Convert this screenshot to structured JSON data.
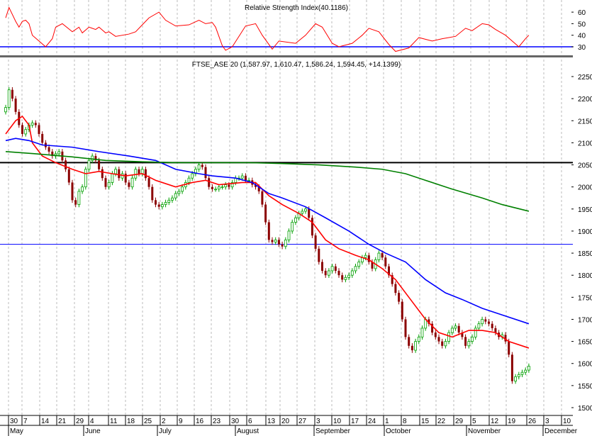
{
  "chart_data": {
    "type": "candlestick",
    "rsi_panel": {
      "title": "Relative Strength Index(40.1186)",
      "y_ticks": [
        "60",
        "50",
        "40",
        "30"
      ],
      "ylim": [
        20,
        68
      ],
      "threshold": 30,
      "color": "#ff0000",
      "threshold_color": "#0000ff",
      "rsi": [
        [
          0,
          55
        ],
        [
          1,
          64
        ],
        [
          3,
          52
        ],
        [
          4,
          47
        ],
        [
          5,
          52
        ],
        [
          6,
          53
        ],
        [
          7,
          50
        ],
        [
          8,
          40
        ],
        [
          10,
          35
        ],
        [
          12,
          30
        ],
        [
          14,
          37
        ],
        [
          15,
          47
        ],
        [
          17,
          50
        ],
        [
          20,
          43
        ],
        [
          22,
          47
        ],
        [
          23,
          42
        ],
        [
          25,
          47
        ],
        [
          27,
          45
        ],
        [
          28,
          47
        ],
        [
          30,
          42
        ],
        [
          31,
          43
        ],
        [
          33,
          39
        ],
        [
          37,
          41
        ],
        [
          39,
          43
        ],
        [
          41,
          49
        ],
        [
          43,
          55
        ],
        [
          46,
          60
        ],
        [
          48,
          53
        ],
        [
          51,
          48
        ],
        [
          55,
          49
        ],
        [
          58,
          53
        ],
        [
          60,
          50
        ],
        [
          62,
          51
        ],
        [
          63,
          47
        ],
        [
          65,
          31
        ],
        [
          66,
          27
        ],
        [
          68,
          30
        ],
        [
          72,
          48
        ],
        [
          75,
          50
        ],
        [
          77,
          40
        ],
        [
          80,
          28
        ],
        [
          82,
          35
        ],
        [
          87,
          33
        ],
        [
          90,
          40
        ],
        [
          93,
          50
        ],
        [
          95,
          47
        ],
        [
          98,
          33
        ],
        [
          100,
          30
        ],
        [
          104,
          33
        ],
        [
          107,
          40
        ],
        [
          109,
          46
        ],
        [
          112,
          43
        ],
        [
          115,
          32
        ],
        [
          117,
          26
        ],
        [
          121,
          29
        ],
        [
          124,
          38
        ],
        [
          128,
          35
        ],
        [
          131,
          37
        ],
        [
          135,
          39
        ],
        [
          138,
          46
        ],
        [
          140,
          44
        ],
        [
          143,
          50
        ],
        [
          145,
          49
        ],
        [
          147,
          45
        ],
        [
          150,
          40
        ],
        [
          154,
          30
        ],
        [
          156,
          37
        ],
        [
          157,
          40
        ]
      ]
    },
    "price_panel": {
      "title": "FTSE_ASE 20 (1,587.97, 1,610.47, 1,586.24, 1,594.45, +14.1399)",
      "ylim": [
        1500,
        2250
      ],
      "y_ticks": [
        "2250",
        "2200",
        "2150",
        "2100",
        "2050",
        "2000",
        "1950",
        "1900",
        "1850",
        "1800",
        "1750",
        "1700",
        "1650",
        "1600",
        "1550",
        "1500"
      ],
      "hlines": [
        {
          "value": 2055,
          "color": "#000000"
        },
        {
          "value": 1870,
          "color": "#0000ff"
        }
      ],
      "up_color": "#00a000",
      "down_color": "#8b0000",
      "closes": [
        2180,
        2220,
        2200,
        2170,
        2140,
        2120,
        2130,
        2140,
        2145,
        2140,
        2120,
        2100,
        2090,
        2080,
        2070,
        2075,
        2080,
        2060,
        2040,
        2010,
        1970,
        1960,
        1990,
        2000,
        2040,
        2060,
        2070,
        2060,
        2040,
        2020,
        2000,
        2010,
        2030,
        2040,
        2020,
        2030,
        2010,
        2000,
        2020,
        2040,
        2030,
        2040,
        2020,
        2000,
        1970,
        1960,
        1955,
        1960,
        1965,
        1970,
        1975,
        1985,
        1990,
        2000,
        2010,
        2020,
        2030,
        2040,
        2050,
        2045,
        2020,
        2000,
        1995,
        1995,
        2000,
        2000,
        2005,
        2000,
        2010,
        2020,
        2020,
        2025,
        2015,
        2015,
        2005,
        2000,
        1990,
        1960,
        1920,
        1880,
        1875,
        1880,
        1870,
        1865,
        1880,
        1900,
        1920,
        1930,
        1940,
        1945,
        1950,
        1930,
        1890,
        1860,
        1830,
        1810,
        1800,
        1810,
        1820,
        1810,
        1800,
        1790,
        1795,
        1800,
        1810,
        1820,
        1830,
        1840,
        1845,
        1830,
        1815,
        1835,
        1850,
        1840,
        1820,
        1800,
        1780,
        1760,
        1740,
        1700,
        1660,
        1640,
        1630,
        1650,
        1660,
        1680,
        1700,
        1690,
        1670,
        1660,
        1650,
        1640,
        1650,
        1670,
        1680,
        1685,
        1670,
        1660,
        1640,
        1650,
        1660,
        1680,
        1690,
        1700,
        1695,
        1690,
        1680,
        1670,
        1660,
        1665,
        1650,
        1620,
        1560,
        1570,
        1575,
        1580,
        1585,
        1594
      ],
      "moving_averages": [
        {
          "name": "short",
          "color": "#ff0000",
          "points": [
            [
              0,
              2120
            ],
            [
              3,
              2150
            ],
            [
              5,
              2160
            ],
            [
              7,
              2140
            ],
            [
              8,
              2100
            ],
            [
              11,
              2070
            ],
            [
              15,
              2055
            ],
            [
              20,
              2040
            ],
            [
              24,
              2030
            ],
            [
              28,
              2035
            ],
            [
              32,
              2030
            ],
            [
              36,
              2025
            ],
            [
              41,
              2030
            ],
            [
              45,
              2015
            ],
            [
              51,
              2000
            ],
            [
              56,
              2010
            ],
            [
              60,
              2015
            ],
            [
              64,
              2005
            ],
            [
              71,
              2010
            ],
            [
              75,
              2010
            ],
            [
              79,
              1980
            ],
            [
              83,
              1960
            ],
            [
              88,
              1940
            ],
            [
              92,
              1920
            ],
            [
              96,
              1880
            ],
            [
              100,
              1860
            ],
            [
              105,
              1845
            ],
            [
              109,
              1835
            ],
            [
              113,
              1815
            ],
            [
              117,
              1790
            ],
            [
              122,
              1740
            ],
            [
              126,
              1700
            ],
            [
              130,
              1670
            ],
            [
              134,
              1660
            ],
            [
              139,
              1675
            ],
            [
              143,
              1675
            ],
            [
              147,
              1670
            ],
            [
              151,
              1650
            ],
            [
              157,
              1635
            ]
          ]
        },
        {
          "name": "medium",
          "color": "#0000ff",
          "points": [
            [
              0,
              2105
            ],
            [
              3,
              2110
            ],
            [
              7,
              2105
            ],
            [
              11,
              2095
            ],
            [
              20,
              2090
            ],
            [
              28,
              2080
            ],
            [
              37,
              2070
            ],
            [
              45,
              2060
            ],
            [
              51,
              2040
            ],
            [
              58,
              2030
            ],
            [
              62,
              2025
            ],
            [
              69,
              2020
            ],
            [
              74,
              2010
            ],
            [
              79,
              1985
            ],
            [
              83,
              1975
            ],
            [
              90,
              1955
            ],
            [
              96,
              1930
            ],
            [
              103,
              1900
            ],
            [
              109,
              1870
            ],
            [
              114,
              1850
            ],
            [
              120,
              1830
            ],
            [
              126,
              1790
            ],
            [
              132,
              1760
            ],
            [
              137,
              1745
            ],
            [
              143,
              1725
            ],
            [
              149,
              1710
            ],
            [
              157,
              1690
            ]
          ]
        },
        {
          "name": "long",
          "color": "#008000",
          "points": [
            [
              0,
              2080
            ],
            [
              9,
              2075
            ],
            [
              20,
              2068
            ],
            [
              30,
              2060
            ],
            [
              41,
              2057
            ],
            [
              51,
              2055
            ],
            [
              62,
              2055
            ],
            [
              73,
              2055
            ],
            [
              83,
              2053
            ],
            [
              94,
              2050
            ],
            [
              105,
              2045
            ],
            [
              113,
              2040
            ],
            [
              120,
              2030
            ],
            [
              126,
              2015
            ],
            [
              134,
              1995
            ],
            [
              143,
              1975
            ],
            [
              149,
              1960
            ],
            [
              157,
              1945
            ]
          ]
        }
      ]
    },
    "x_axis": {
      "day_labels": [
        "30",
        "7",
        "14",
        "21",
        "29",
        "4",
        "11",
        "18",
        "25",
        "2",
        "9",
        "16",
        "23",
        "30",
        "6",
        "13",
        "20",
        "27",
        "3",
        "10",
        "17",
        "24",
        "1",
        "8",
        "15",
        "22",
        "29",
        "5",
        "12",
        "19",
        "26",
        "3",
        "10"
      ],
      "month_labels": [
        "May",
        "June",
        "July",
        "August",
        "September",
        "October",
        "November",
        "December"
      ]
    }
  }
}
